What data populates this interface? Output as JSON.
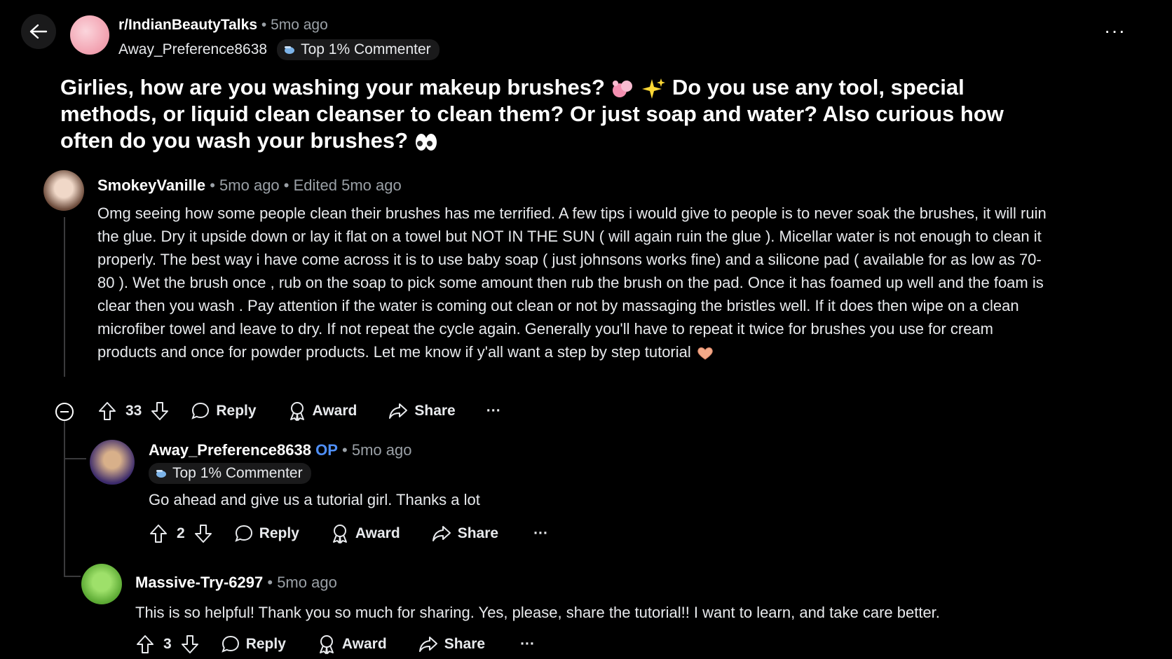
{
  "post": {
    "subreddit": "r/IndianBeautyTalks",
    "time": "5mo ago",
    "author": "Away_Preference8638",
    "flair": "Top 1% Commenter",
    "title_part1": "Girlies, how are you washing your makeup brushes?",
    "title_part2": "Do you use any tool, special methods, or liquid clean cleanser to clean them? Or just soap and water? Also curious how often do you wash your brushes?"
  },
  "comments": [
    {
      "author": "SmokeyVanille",
      "time": "5mo ago",
      "edited": "Edited 5mo ago",
      "body": "Omg seeing how some people clean their brushes has me terrified. A few tips i would give to people is to never soak the brushes, it will ruin the glue. Dry it upside down or lay it flat on a towel but NOT IN THE SUN ( will again ruin the glue ). Micellar water is not enough to clean it properly. The best way i have come across it is to use baby soap ( just johnsons works fine) and a silicone pad ( available for as low as 70-80 ). Wet the brush once , rub on the soap to pick some amount then rub the brush on the pad. Once it has foamed up well and the foam is clear then you wash . Pay attention if the water is coming out clean or not by massaging the bristles well. If it does then wipe on a clean microfiber towel and leave to dry. If not repeat the cycle again. Generally you'll have to repeat it twice for brushes you use for cream products and once for powder products. Let me know if y'all want a step by step tutorial",
      "votes": "33"
    },
    {
      "author": "Away_Preference8638",
      "op": "OP",
      "time": "5mo ago",
      "flair": "Top 1% Commenter",
      "body": "Go ahead and give us a tutorial girl. Thanks a lot",
      "votes": "2"
    },
    {
      "author": "Massive-Try-6297",
      "time": "5mo ago",
      "body": "This is so helpful! Thank you so much for sharing. Yes, please, share the tutorial!! I want to learn, and take care better.",
      "votes": "3"
    }
  ],
  "actions": {
    "reply": "Reply",
    "award": "Award",
    "share": "Share",
    "more": "···"
  },
  "separator": "•"
}
